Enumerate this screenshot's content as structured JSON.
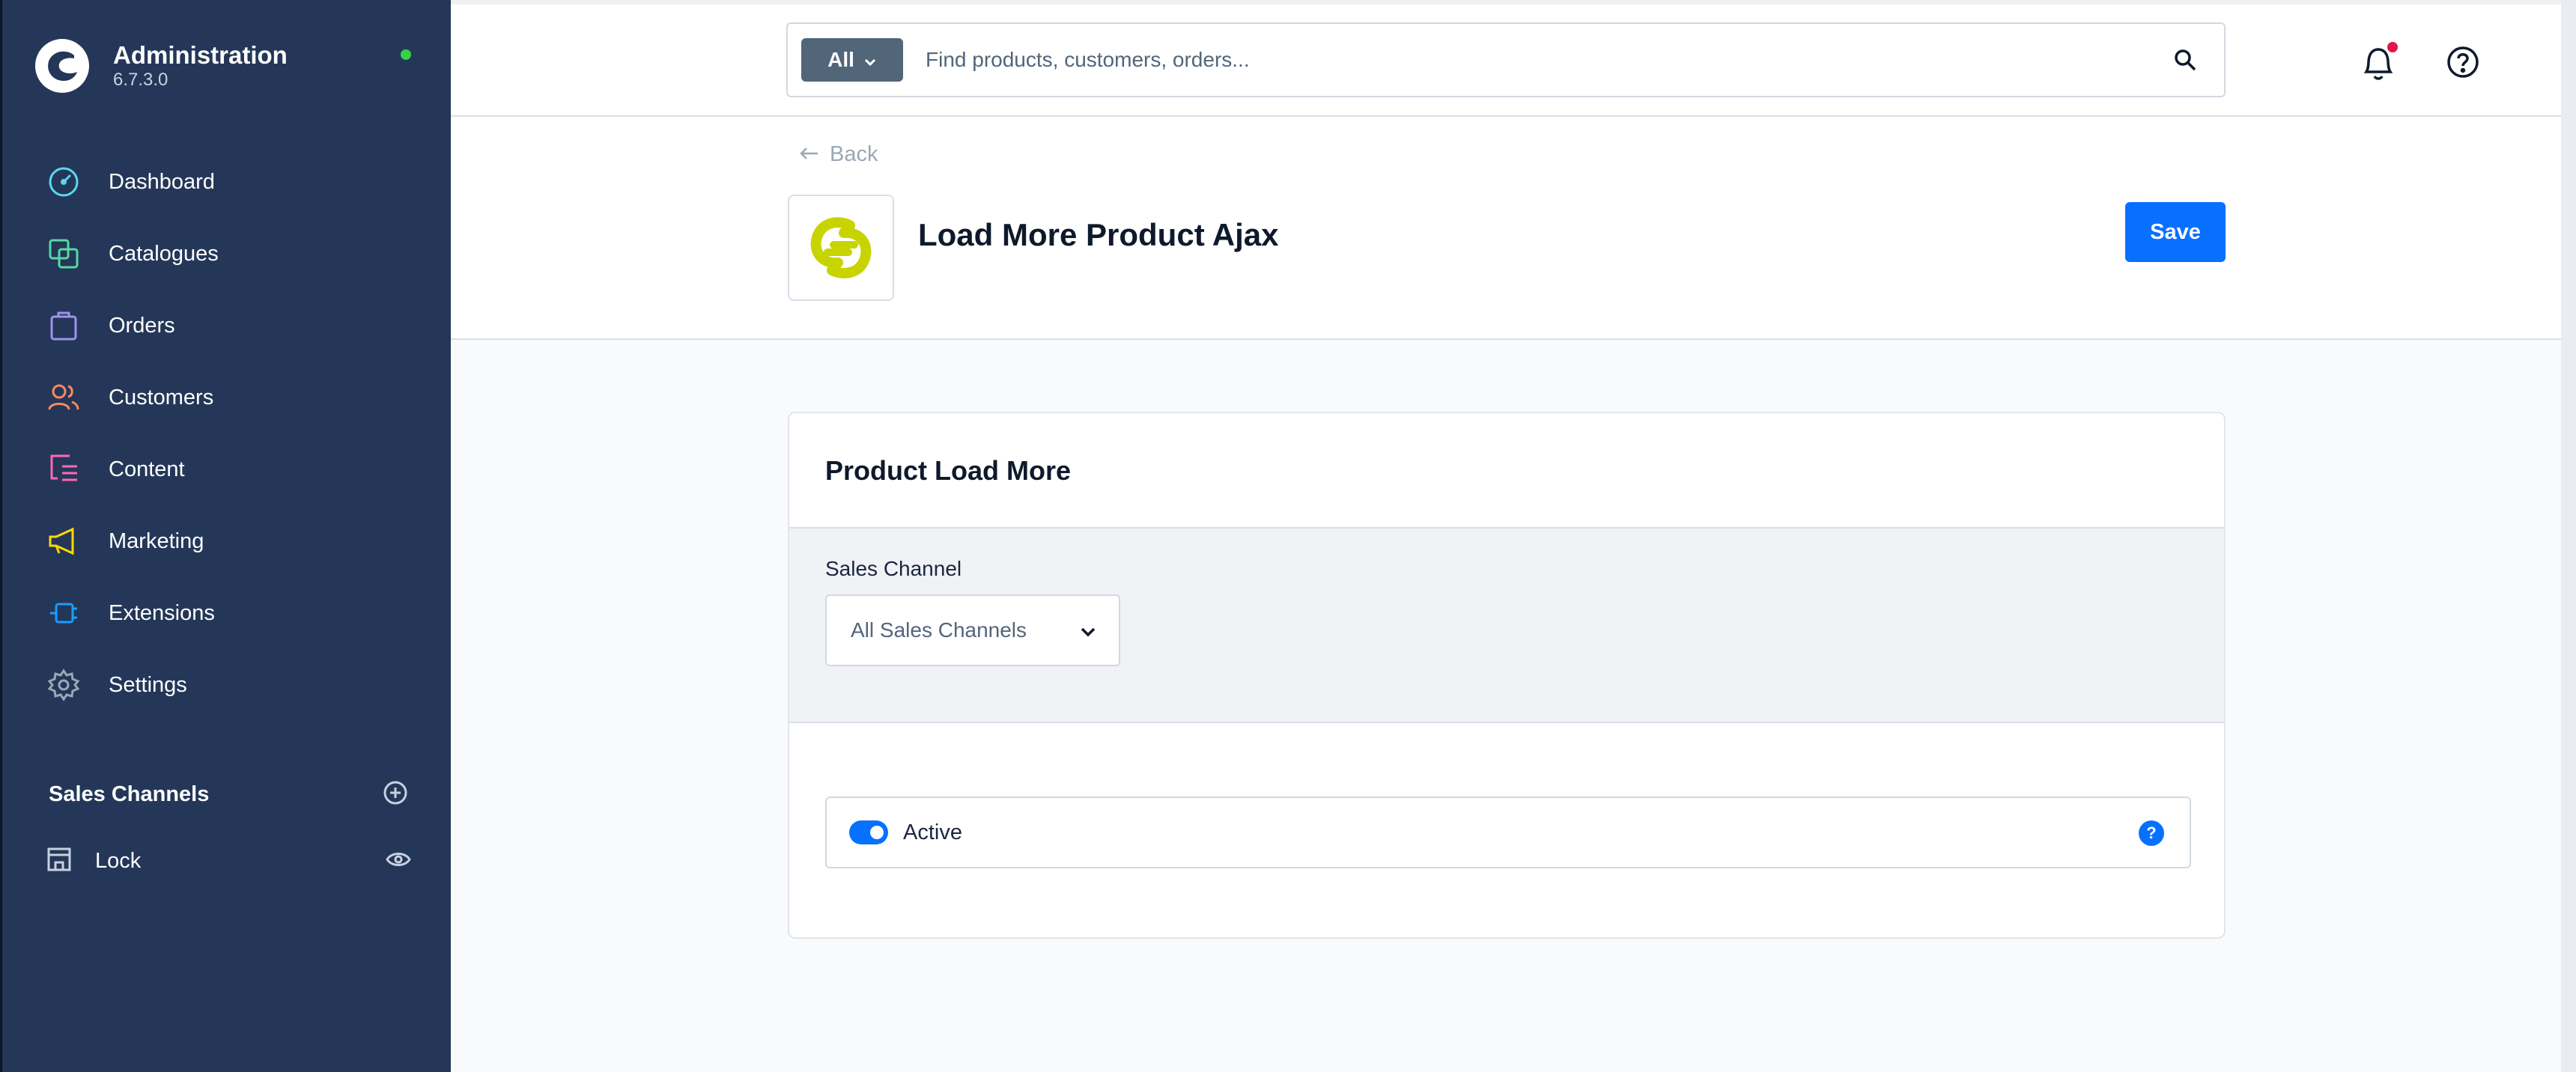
{
  "app": {
    "title": "Administration",
    "version": "6.7.3.0",
    "status_color": "#37d046"
  },
  "sidebar": {
    "items": [
      {
        "label": "Dashboard",
        "icon": "dashboard-icon",
        "color": "#57d9f1"
      },
      {
        "label": "Catalogues",
        "icon": "catalogues-icon",
        "color": "#57d9a3"
      },
      {
        "label": "Orders",
        "icon": "orders-icon",
        "color": "#a092f0"
      },
      {
        "label": "Customers",
        "icon": "customers-icon",
        "color": "#f88962"
      },
      {
        "label": "Content",
        "icon": "content-icon",
        "color": "#ff68b4"
      },
      {
        "label": "Marketing",
        "icon": "marketing-icon",
        "color": "#ffd700"
      },
      {
        "label": "Extensions",
        "icon": "extensions-icon",
        "color": "#189eff"
      },
      {
        "label": "Settings",
        "icon": "settings-icon",
        "color": "#9aa8b5"
      }
    ],
    "sales_channels": {
      "title": "Sales Channels",
      "items": [
        {
          "label": "Lock",
          "icon": "storefront-icon"
        }
      ]
    }
  },
  "topbar": {
    "search_type": "All",
    "search_placeholder": "Find products, customers, orders...",
    "notification_dot_color": "#e3154c"
  },
  "header": {
    "back_label": "Back",
    "title": "Load More Product Ajax",
    "save_label": "Save",
    "accent_color": "#0870ff"
  },
  "card": {
    "title": "Product Load More",
    "sales_channel_label": "Sales Channel",
    "sales_channel_value": "All Sales Channels",
    "active_label": "Active",
    "active_value": true,
    "help_glyph": "?"
  }
}
